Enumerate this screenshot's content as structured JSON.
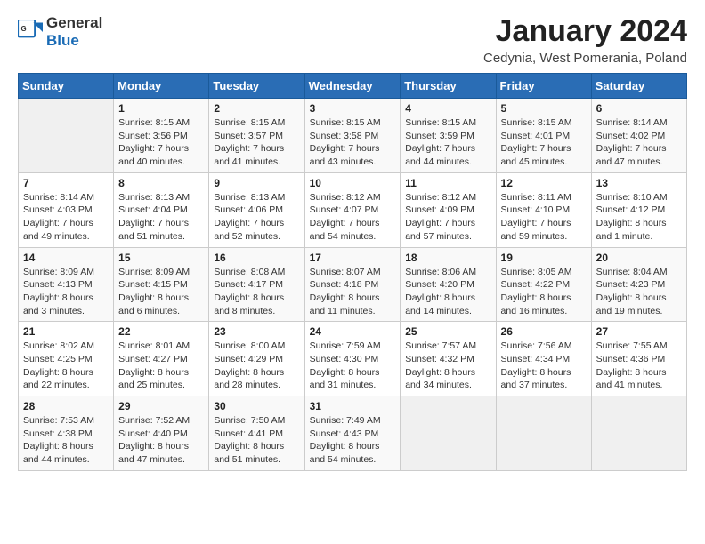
{
  "header": {
    "logo_general": "General",
    "logo_blue": "Blue",
    "month_title": "January 2024",
    "location": "Cedynia, West Pomerania, Poland"
  },
  "days_of_week": [
    "Sunday",
    "Monday",
    "Tuesday",
    "Wednesday",
    "Thursday",
    "Friday",
    "Saturday"
  ],
  "weeks": [
    [
      {
        "day": "",
        "info": ""
      },
      {
        "day": "1",
        "info": "Sunrise: 8:15 AM\nSunset: 3:56 PM\nDaylight: 7 hours\nand 40 minutes."
      },
      {
        "day": "2",
        "info": "Sunrise: 8:15 AM\nSunset: 3:57 PM\nDaylight: 7 hours\nand 41 minutes."
      },
      {
        "day": "3",
        "info": "Sunrise: 8:15 AM\nSunset: 3:58 PM\nDaylight: 7 hours\nand 43 minutes."
      },
      {
        "day": "4",
        "info": "Sunrise: 8:15 AM\nSunset: 3:59 PM\nDaylight: 7 hours\nand 44 minutes."
      },
      {
        "day": "5",
        "info": "Sunrise: 8:15 AM\nSunset: 4:01 PM\nDaylight: 7 hours\nand 45 minutes."
      },
      {
        "day": "6",
        "info": "Sunrise: 8:14 AM\nSunset: 4:02 PM\nDaylight: 7 hours\nand 47 minutes."
      }
    ],
    [
      {
        "day": "7",
        "info": "Sunrise: 8:14 AM\nSunset: 4:03 PM\nDaylight: 7 hours\nand 49 minutes."
      },
      {
        "day": "8",
        "info": "Sunrise: 8:13 AM\nSunset: 4:04 PM\nDaylight: 7 hours\nand 51 minutes."
      },
      {
        "day": "9",
        "info": "Sunrise: 8:13 AM\nSunset: 4:06 PM\nDaylight: 7 hours\nand 52 minutes."
      },
      {
        "day": "10",
        "info": "Sunrise: 8:12 AM\nSunset: 4:07 PM\nDaylight: 7 hours\nand 54 minutes."
      },
      {
        "day": "11",
        "info": "Sunrise: 8:12 AM\nSunset: 4:09 PM\nDaylight: 7 hours\nand 57 minutes."
      },
      {
        "day": "12",
        "info": "Sunrise: 8:11 AM\nSunset: 4:10 PM\nDaylight: 7 hours\nand 59 minutes."
      },
      {
        "day": "13",
        "info": "Sunrise: 8:10 AM\nSunset: 4:12 PM\nDaylight: 8 hours\nand 1 minute."
      }
    ],
    [
      {
        "day": "14",
        "info": "Sunrise: 8:09 AM\nSunset: 4:13 PM\nDaylight: 8 hours\nand 3 minutes."
      },
      {
        "day": "15",
        "info": "Sunrise: 8:09 AM\nSunset: 4:15 PM\nDaylight: 8 hours\nand 6 minutes."
      },
      {
        "day": "16",
        "info": "Sunrise: 8:08 AM\nSunset: 4:17 PM\nDaylight: 8 hours\nand 8 minutes."
      },
      {
        "day": "17",
        "info": "Sunrise: 8:07 AM\nSunset: 4:18 PM\nDaylight: 8 hours\nand 11 minutes."
      },
      {
        "day": "18",
        "info": "Sunrise: 8:06 AM\nSunset: 4:20 PM\nDaylight: 8 hours\nand 14 minutes."
      },
      {
        "day": "19",
        "info": "Sunrise: 8:05 AM\nSunset: 4:22 PM\nDaylight: 8 hours\nand 16 minutes."
      },
      {
        "day": "20",
        "info": "Sunrise: 8:04 AM\nSunset: 4:23 PM\nDaylight: 8 hours\nand 19 minutes."
      }
    ],
    [
      {
        "day": "21",
        "info": "Sunrise: 8:02 AM\nSunset: 4:25 PM\nDaylight: 8 hours\nand 22 minutes."
      },
      {
        "day": "22",
        "info": "Sunrise: 8:01 AM\nSunset: 4:27 PM\nDaylight: 8 hours\nand 25 minutes."
      },
      {
        "day": "23",
        "info": "Sunrise: 8:00 AM\nSunset: 4:29 PM\nDaylight: 8 hours\nand 28 minutes."
      },
      {
        "day": "24",
        "info": "Sunrise: 7:59 AM\nSunset: 4:30 PM\nDaylight: 8 hours\nand 31 minutes."
      },
      {
        "day": "25",
        "info": "Sunrise: 7:57 AM\nSunset: 4:32 PM\nDaylight: 8 hours\nand 34 minutes."
      },
      {
        "day": "26",
        "info": "Sunrise: 7:56 AM\nSunset: 4:34 PM\nDaylight: 8 hours\nand 37 minutes."
      },
      {
        "day": "27",
        "info": "Sunrise: 7:55 AM\nSunset: 4:36 PM\nDaylight: 8 hours\nand 41 minutes."
      }
    ],
    [
      {
        "day": "28",
        "info": "Sunrise: 7:53 AM\nSunset: 4:38 PM\nDaylight: 8 hours\nand 44 minutes."
      },
      {
        "day": "29",
        "info": "Sunrise: 7:52 AM\nSunset: 4:40 PM\nDaylight: 8 hours\nand 47 minutes."
      },
      {
        "day": "30",
        "info": "Sunrise: 7:50 AM\nSunset: 4:41 PM\nDaylight: 8 hours\nand 51 minutes."
      },
      {
        "day": "31",
        "info": "Sunrise: 7:49 AM\nSunset: 4:43 PM\nDaylight: 8 hours\nand 54 minutes."
      },
      {
        "day": "",
        "info": ""
      },
      {
        "day": "",
        "info": ""
      },
      {
        "day": "",
        "info": ""
      }
    ]
  ]
}
